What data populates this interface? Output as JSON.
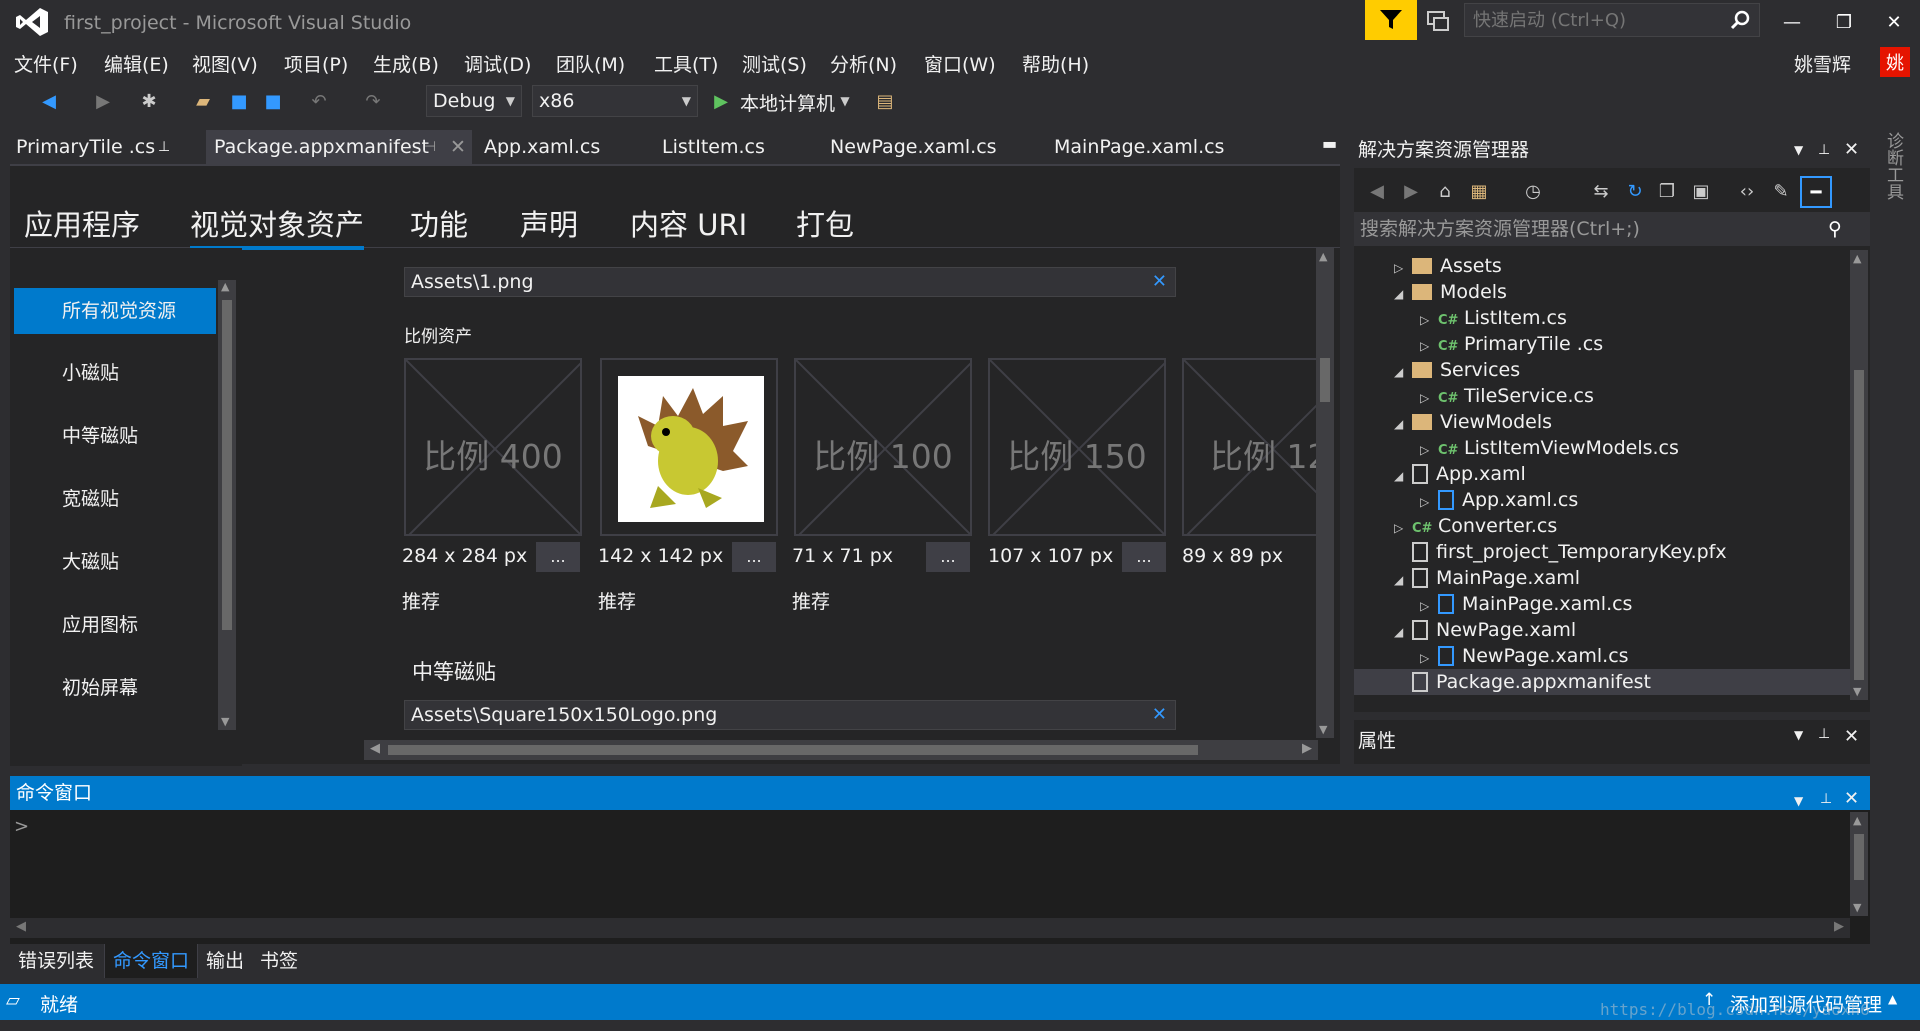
{
  "title_bar": {
    "title": "first_project - Microsoft Visual Studio",
    "quick_launch_placeholder": "快速启动 (Ctrl+Q)",
    "minimize": "—",
    "restore": "❐",
    "close": "✕"
  },
  "menu": [
    "文件(F)",
    "编辑(E)",
    "视图(V)",
    "项目(P)",
    "生成(B)",
    "调试(D)",
    "团队(M)",
    "工具(T)",
    "测试(S)",
    "分析(N)",
    "窗口(W)",
    "帮助(H)"
  ],
  "user": {
    "name": "姚雪辉",
    "avatar": "姚"
  },
  "toolbar": {
    "config": "Debug",
    "platform": "x86",
    "run_label": "本地计算机"
  },
  "doc_tabs": [
    "PrimaryTile .cs",
    "Package.appxmanifest",
    "App.xaml.cs",
    "ListItem.cs",
    "NewPage.xaml.cs",
    "MainPage.xaml.cs"
  ],
  "manifest_tabs": [
    "应用程序",
    "视觉对象资产",
    "功能",
    "声明",
    "内容 URI",
    "打包"
  ],
  "left_nav": [
    "所有视觉资源",
    "小磁贴",
    "中等磁贴",
    "宽磁贴",
    "大磁贴",
    "应用图标",
    "初始屏幕"
  ],
  "editor": {
    "asset_path_1": "Assets\\1.png",
    "scale_assets_label": "比例资产",
    "scales": [
      {
        "label": "比例 400",
        "size": "284 x 284 px",
        "note": "推荐"
      },
      {
        "label": "",
        "size": "142 x 142 px",
        "note": "推荐"
      },
      {
        "label": "比例 100",
        "size": "71 x 71 px",
        "note": "推荐"
      },
      {
        "label": "比例 150",
        "size": "107 x 107 px",
        "note": ""
      },
      {
        "label": "比例 12",
        "size": "89 x 89 px",
        "note": ""
      }
    ],
    "dots": "...",
    "medium_tile_heading": "中等磁贴",
    "asset_path_2": "Assets\\Square150x150Logo.png"
  },
  "solution_explorer": {
    "title": "解决方案资源管理器",
    "search_placeholder": "搜索解决方案资源管理器(Ctrl+;)",
    "items": [
      {
        "label": "Assets",
        "kind": "folder",
        "expanded": false
      },
      {
        "label": "Models",
        "kind": "folder",
        "expanded": true
      },
      {
        "label": "ListItem.cs",
        "kind": "cs"
      },
      {
        "label": "PrimaryTile .cs",
        "kind": "cs"
      },
      {
        "label": "Services",
        "kind": "folder",
        "expanded": true
      },
      {
        "label": "TileService.cs",
        "kind": "cs"
      },
      {
        "label": "ViewModels",
        "kind": "folder",
        "expanded": true
      },
      {
        "label": "ListItemViewModels.cs",
        "kind": "cs"
      },
      {
        "label": "App.xaml",
        "kind": "doc",
        "expanded": true
      },
      {
        "label": "App.xaml.cs",
        "kind": "doc"
      },
      {
        "label": "Converter.cs",
        "kind": "cs"
      },
      {
        "label": "first_project_TemporaryKey.pfx",
        "kind": "doc"
      },
      {
        "label": "MainPage.xaml",
        "kind": "doc",
        "expanded": true
      },
      {
        "label": "MainPage.xaml.cs",
        "kind": "doc"
      },
      {
        "label": "NewPage.xaml",
        "kind": "doc",
        "expanded": true
      },
      {
        "label": "NewPage.xaml.cs",
        "kind": "doc"
      },
      {
        "label": "Package.appxmanifest",
        "kind": "doc",
        "selected": true
      }
    ]
  },
  "properties": {
    "title": "属性"
  },
  "command_window": {
    "title": "命令窗口",
    "prompt": ">"
  },
  "bottom_tabs": [
    "错误列表",
    "命令窗口",
    "输出",
    "书签"
  ],
  "side_panel": "诊断工具",
  "status": {
    "text": "就绪",
    "right": "添加到源代码管理"
  },
  "watermark": "https://blog.csdn.net/yaoxh6",
  "colors": {
    "accent": "#007acc",
    "bg": "#2d2d30",
    "panel": "#252526",
    "filter": "#ffcc00"
  }
}
